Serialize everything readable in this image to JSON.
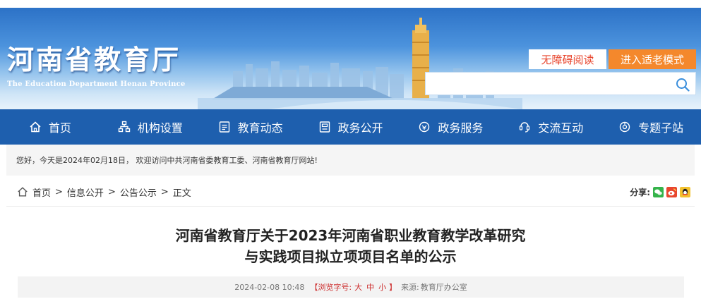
{
  "header": {
    "title": "河南省教育厅",
    "subtitle": "The Education Department Henan Province",
    "accessibility_label": "无障碍阅读",
    "elder_mode_label": "进入适老模式",
    "search": {
      "placeholder": "",
      "value": ""
    }
  },
  "nav": {
    "items": [
      {
        "label": "首页",
        "icon": "home-icon"
      },
      {
        "label": "机构设置",
        "icon": "org-icon"
      },
      {
        "label": "教育动态",
        "icon": "news-icon"
      },
      {
        "label": "政务公开",
        "icon": "open-gov-icon"
      },
      {
        "label": "政务服务",
        "icon": "service-icon"
      },
      {
        "label": "交流互动",
        "icon": "interact-icon"
      },
      {
        "label": "专题子站",
        "icon": "subsite-icon"
      }
    ]
  },
  "welcome_text": "您好，今天是2024年02月18日， 欢迎访问中共河南省委教育工委、河南省教育厅网站!",
  "breadcrumb": {
    "items": [
      "首页",
      "信息公开",
      "公告公示",
      "正文"
    ],
    "separator": ">"
  },
  "share": {
    "label": "分享:",
    "targets": [
      "wechat",
      "weibo",
      "qq"
    ]
  },
  "article": {
    "title_line1": "河南省教育厅关于2023年河南省职业教育教学改革研究",
    "title_line2": "与实践项目拟立项项目名单的公示",
    "date": "2024-02-08 10:48",
    "font_size_prefix": "【浏览字号:",
    "font_size_large": "大",
    "font_size_medium": "中",
    "font_size_small": "小",
    "font_size_suffix": "】",
    "source_label": "来源:",
    "source": "教育厅办公室"
  },
  "colors": {
    "nav_bg": "#1e5fae",
    "accent_orange": "#f4882c",
    "accent_red": "#e8462e"
  }
}
